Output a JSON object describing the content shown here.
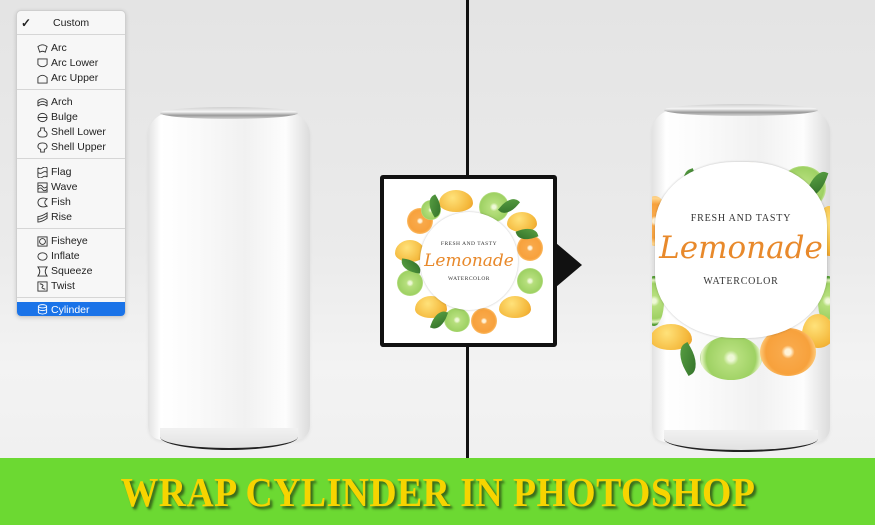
{
  "warp_menu": {
    "selected_item": "Cylinder",
    "groups": [
      [
        {
          "label": "Custom",
          "icon": "checkmark-icon",
          "checked": true
        }
      ],
      [
        {
          "label": "Arc",
          "icon": "warp-arc-icon"
        },
        {
          "label": "Arc Lower",
          "icon": "warp-arc-lower-icon"
        },
        {
          "label": "Arc Upper",
          "icon": "warp-arc-upper-icon"
        }
      ],
      [
        {
          "label": "Arch",
          "icon": "warp-arch-icon"
        },
        {
          "label": "Bulge",
          "icon": "warp-bulge-icon"
        },
        {
          "label": "Shell Lower",
          "icon": "warp-shell-lower-icon"
        },
        {
          "label": "Shell Upper",
          "icon": "warp-shell-upper-icon"
        }
      ],
      [
        {
          "label": "Flag",
          "icon": "warp-flag-icon"
        },
        {
          "label": "Wave",
          "icon": "warp-wave-icon"
        },
        {
          "label": "Fish",
          "icon": "warp-fish-icon"
        },
        {
          "label": "Rise",
          "icon": "warp-rise-icon"
        }
      ],
      [
        {
          "label": "Fisheye",
          "icon": "warp-fisheye-icon"
        },
        {
          "label": "Inflate",
          "icon": "warp-inflate-icon"
        },
        {
          "label": "Squeeze",
          "icon": "warp-squeeze-icon"
        },
        {
          "label": "Twist",
          "icon": "warp-twist-icon"
        }
      ],
      [
        {
          "label": "Cylinder",
          "icon": "warp-cylinder-icon",
          "selected": true
        }
      ]
    ]
  },
  "label_design": {
    "top_line": "FRESH AND TASTY",
    "title": "Lemonade",
    "bottom_line": "WATERCOLOR"
  },
  "wrapped_can_label": {
    "top_line": "FRESH AND TASTY",
    "title": "Lemonade",
    "bottom_line": "WATERCOLOR"
  },
  "banner": {
    "title": "WRAP CYLINDER IN PHOTOSHOP"
  },
  "colors": {
    "banner_background": "#6cd932",
    "banner_text": "#f7d400",
    "menu_selection": "#1a73e8",
    "script_title": "#e8892b"
  }
}
